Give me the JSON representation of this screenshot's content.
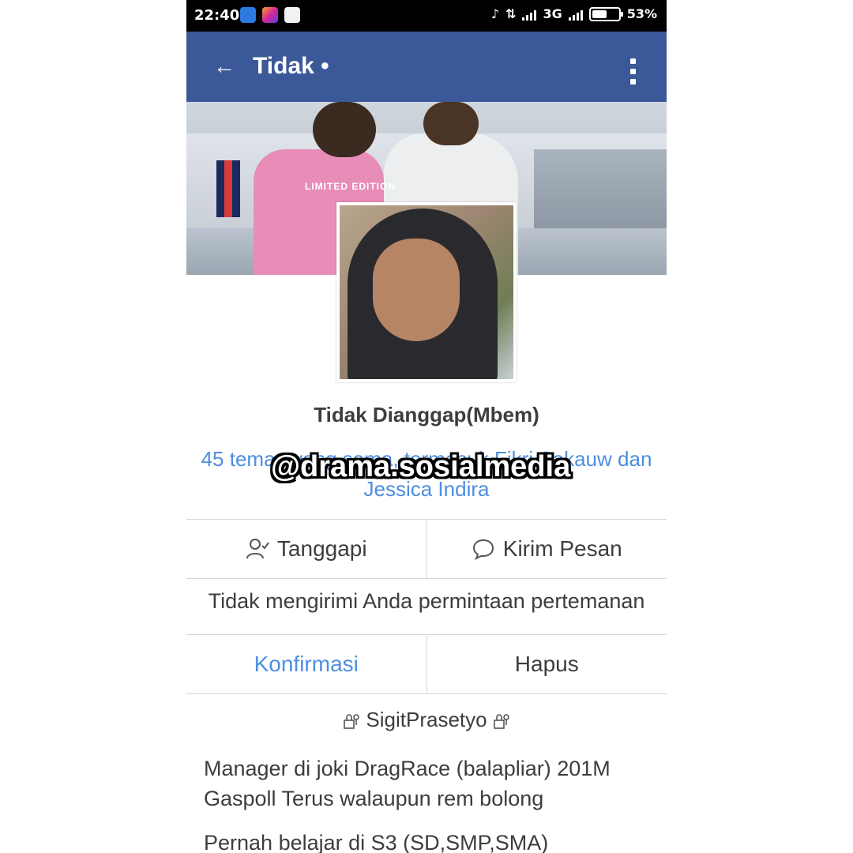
{
  "statusbar": {
    "time": "22:40",
    "network": "3G",
    "battery": "53%"
  },
  "appbar": {
    "back_icon": "←",
    "title": "Tidak •"
  },
  "cover": {
    "shirt_text": "LIMITED EDITION"
  },
  "profile": {
    "name": "Tidak Dianggap(Mbem)",
    "mutual_friends": "45 teman yang sama, termasuk Fikri Sakauw dan Jessica Indira"
  },
  "actions": {
    "respond_label": "Tanggapi",
    "message_label": "Kirim Pesan"
  },
  "friend_request": {
    "text": "Tidak mengirimi Anda permintaan pertemanan",
    "confirm_label": "Konfirmasi",
    "delete_label": "Hapus"
  },
  "bio": {
    "name": "SigitPrasetyo",
    "line1": "Manager di joki DragRace (balapliar) 201M",
    "line2": "Gaspoll Terus walaupun rem bolong",
    "line3": "Pernah belajar di S3 (SD,SMP,SMA)"
  },
  "watermark": "@drama.sosialmedia",
  "colors": {
    "appbar": "#3b5998",
    "link": "#4d8ee0"
  }
}
